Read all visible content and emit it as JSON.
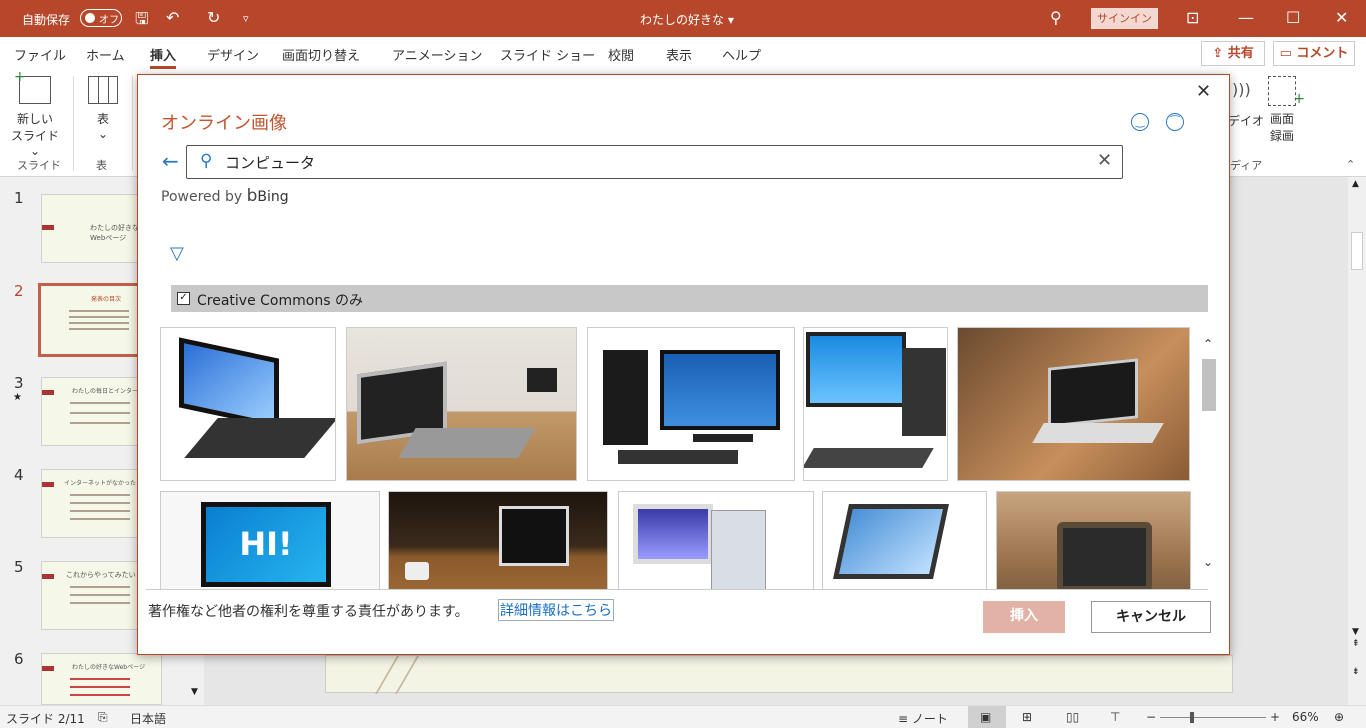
{
  "titlebar": {
    "autosave_label": "自動保存",
    "autosave_state": "オフ",
    "doc_title": "わたしの好きな ▾",
    "signin": "サインイン"
  },
  "tabs": [
    "ファイル",
    "ホーム",
    "挿入",
    "デザイン",
    "画面切り替え",
    "アニメーション",
    "スライド ショー",
    "校閲",
    "表示",
    "ヘルプ"
  ],
  "active_tab": "挿入",
  "share": "共有",
  "comment": "コメント",
  "ribbon": {
    "new_slide": "新しい",
    "new_slide2": "スライド ⌄",
    "group_slides": "スライド",
    "table": "表",
    "table_caret": "⌄",
    "group_table": "表",
    "video": "デイオ",
    "record": "画面",
    "record2": "録画",
    "group_media": "ディア"
  },
  "slides": [
    {
      "num": "1",
      "title": "わたしの好きな Webページ"
    },
    {
      "num": "2",
      "title": "発表の目次"
    },
    {
      "num": "3",
      "title": "わたしの毎日とインターネ"
    },
    {
      "num": "4",
      "title": "インターネットがなかったら"
    },
    {
      "num": "5",
      "title": "これからやってみたい"
    },
    {
      "num": "6",
      "title": "わたしの好きなWebページ"
    }
  ],
  "status": {
    "slide": "スライド 2/11",
    "lang": "日本語",
    "notes": "ノート",
    "zoom": "66%"
  },
  "dialog": {
    "title": "オンライン画像",
    "search_value": "コンピュータ",
    "powered_by": "Powered by",
    "bing": "Bing",
    "cc_filter": "Creative Commons のみ",
    "hi_text": "HI!",
    "legal": "著作権など他者の権利を尊重する責任があります。",
    "link": "詳細情報はこちら",
    "insert": "挿入",
    "cancel": "キャンセル"
  },
  "colors": {
    "accent": "#b7472a",
    "link": "#1a6fc4"
  }
}
